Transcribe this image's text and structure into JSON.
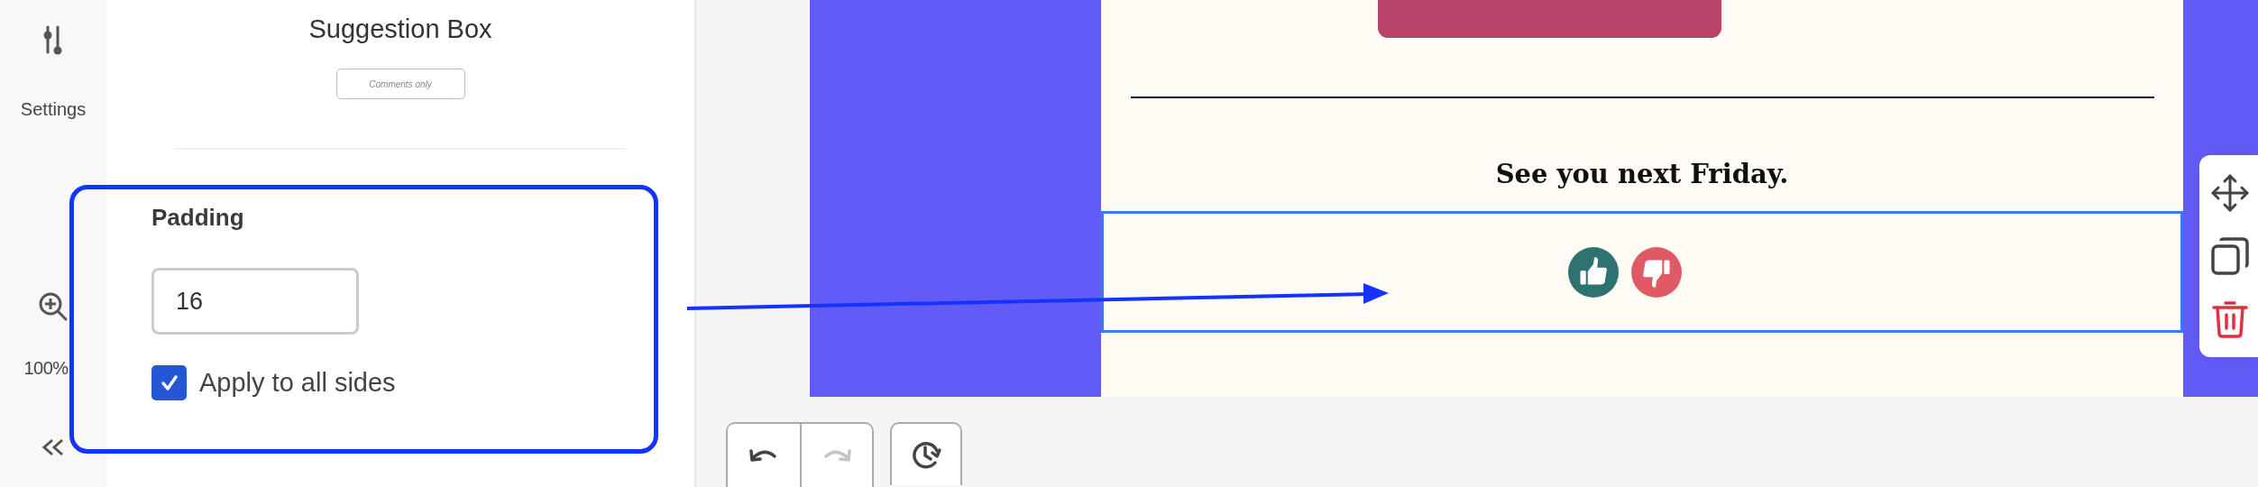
{
  "rail": {
    "items": [
      {
        "kind": "settings",
        "label": "Settings"
      },
      {
        "kind": "zoom",
        "label": "100%"
      },
      {
        "kind": "collapse"
      }
    ]
  },
  "panel": {
    "title": "Suggestion Box",
    "badge": "Comments only",
    "padding": {
      "label": "Padding",
      "value": "16",
      "apply_all": {
        "label": "Apply to all sides",
        "checked": true
      }
    }
  },
  "email": {
    "closing": "See you next Friday.",
    "feedback_block": {
      "selected": true,
      "buttons": [
        {
          "kind": "up",
          "color": "#2f7272"
        },
        {
          "kind": "down",
          "color": "#e05a66"
        }
      ]
    }
  },
  "block_actions": [
    {
      "kind": "move"
    },
    {
      "kind": "duplicate"
    },
    {
      "kind": "delete"
    }
  ],
  "history_toolbar": [
    {
      "kind": "undo",
      "disabled": false
    },
    {
      "kind": "redo",
      "disabled": true
    },
    {
      "kind": "history",
      "disabled": false
    }
  ]
}
